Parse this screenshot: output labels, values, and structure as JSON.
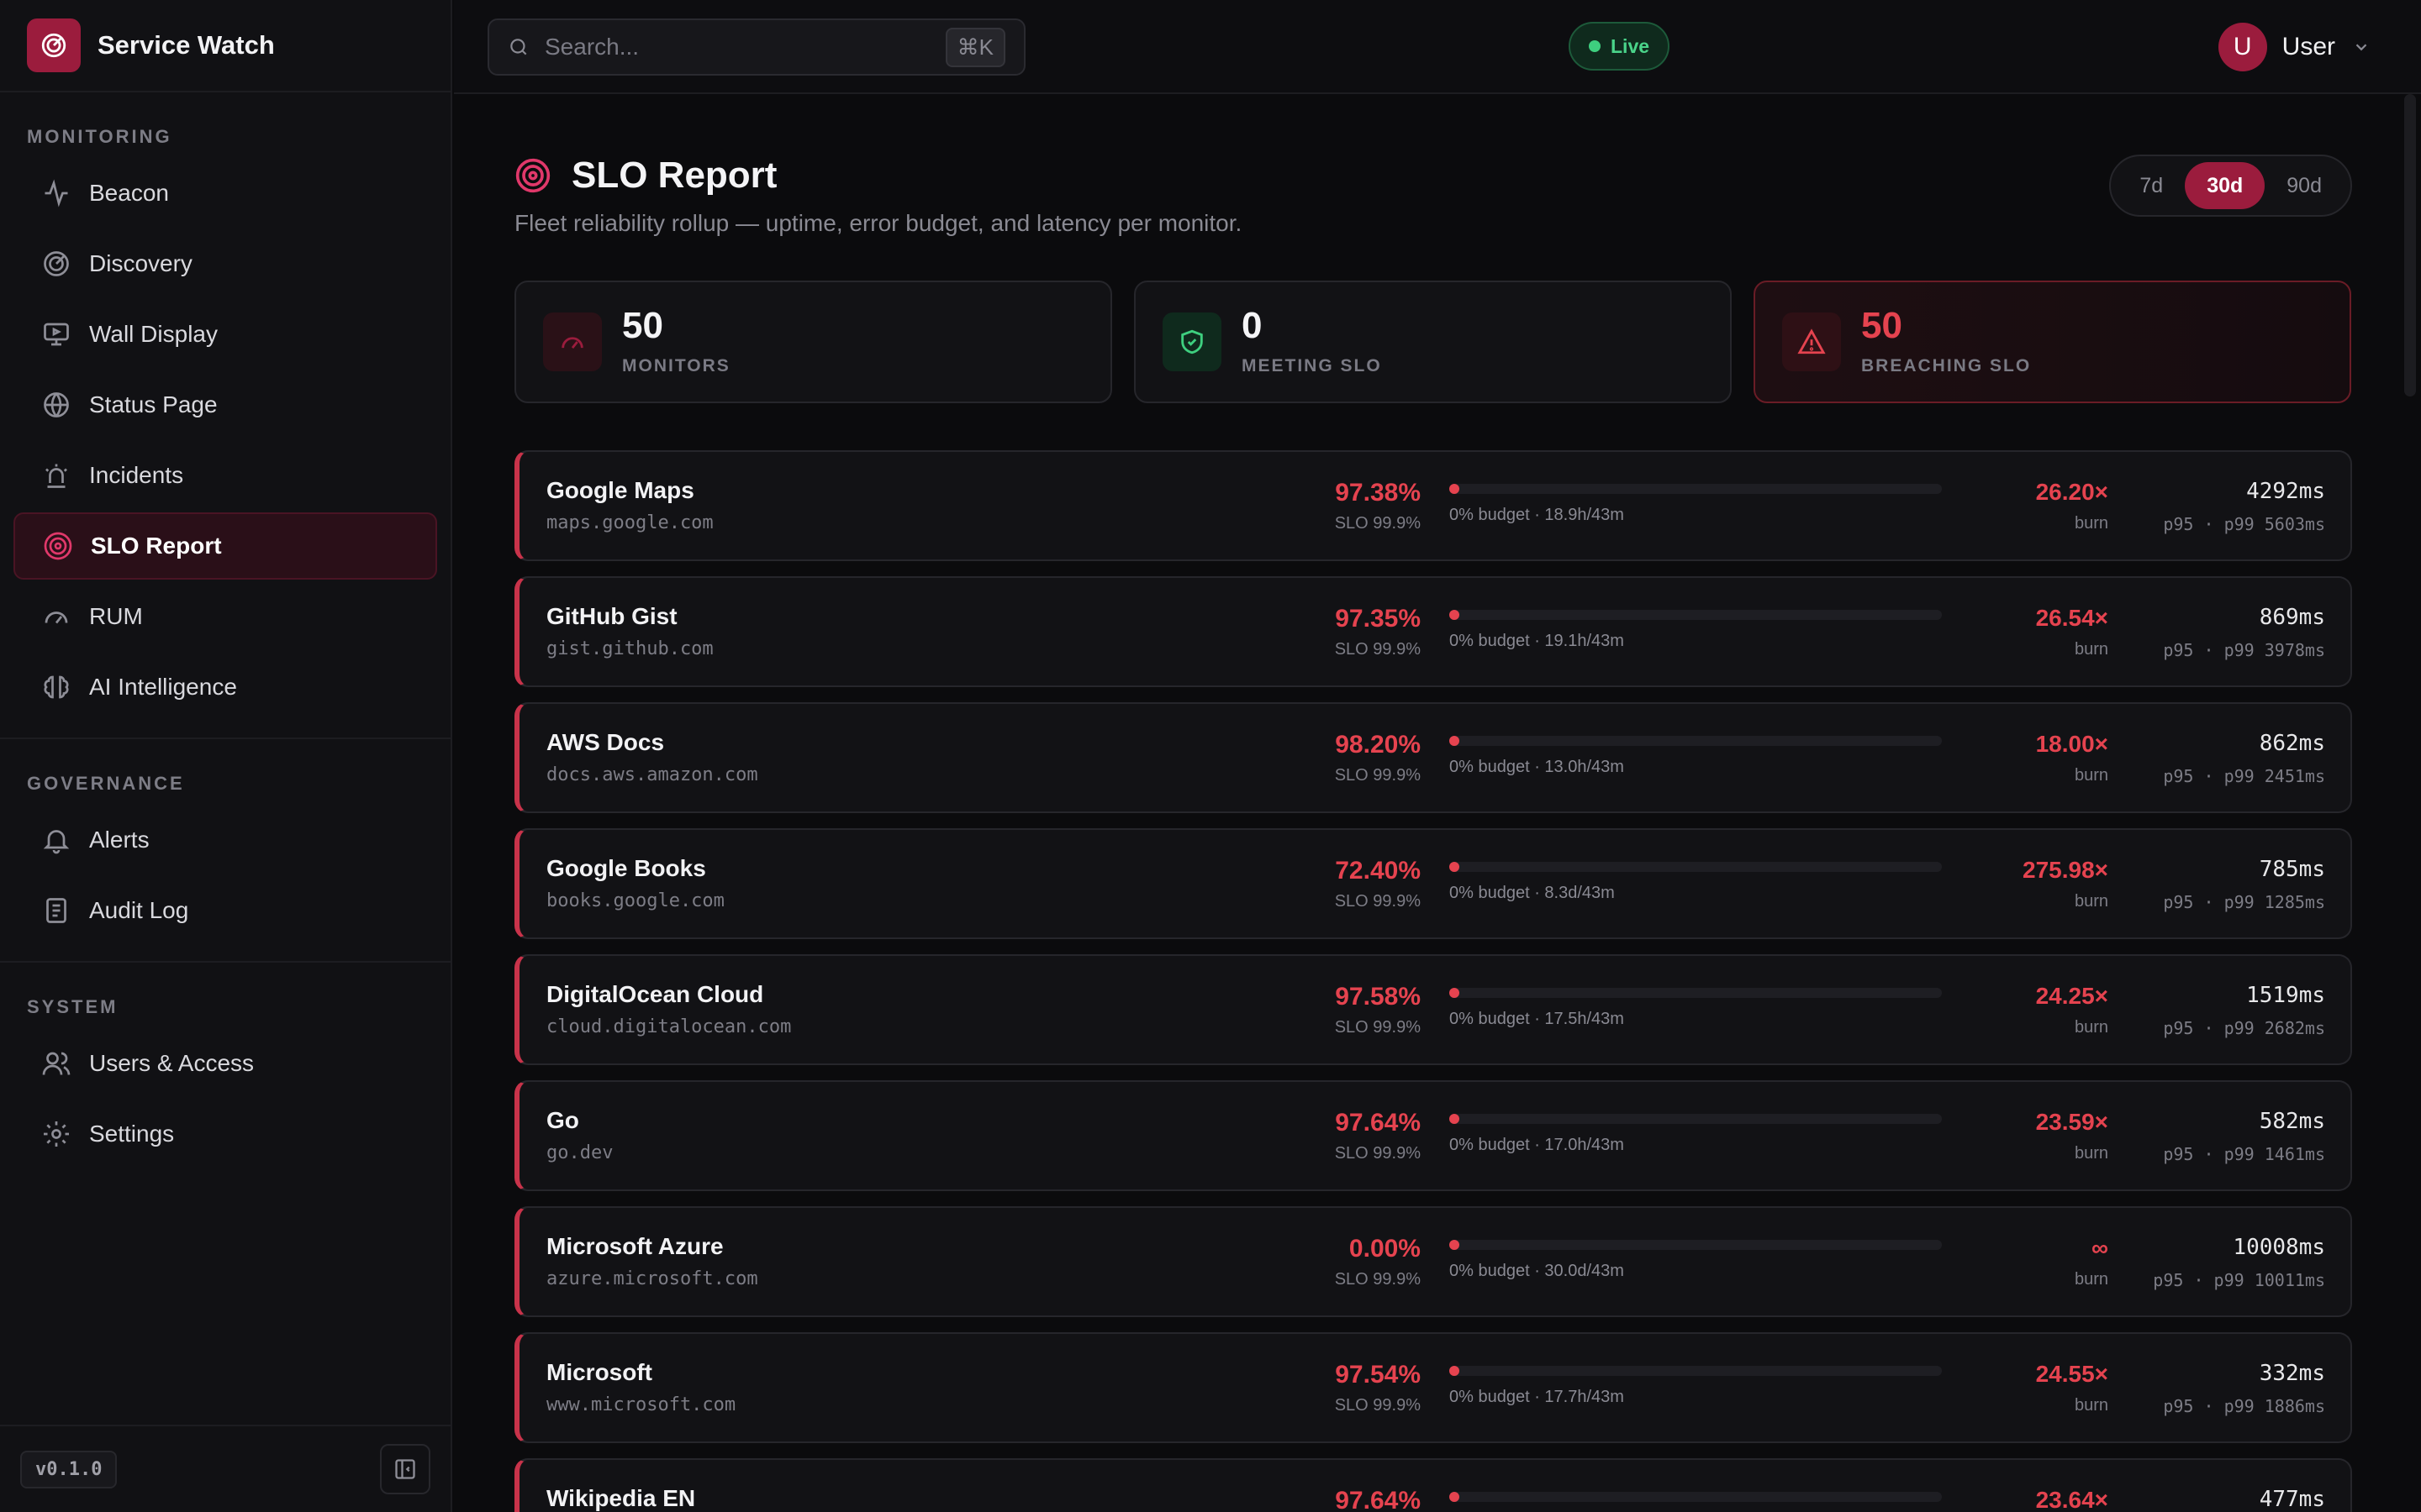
{
  "brand": {
    "name": "Service Watch"
  },
  "sidebar": {
    "sections": [
      {
        "heading": "MONITORING",
        "items": [
          {
            "label": "Beacon",
            "icon": "activity-icon"
          },
          {
            "label": "Discovery",
            "icon": "radar-icon"
          },
          {
            "label": "Wall Display",
            "icon": "monitor-icon"
          },
          {
            "label": "Status Page",
            "icon": "globe-icon"
          },
          {
            "label": "Incidents",
            "icon": "siren-icon"
          },
          {
            "label": "SLO Report",
            "icon": "target-icon",
            "active": true
          },
          {
            "label": "RUM",
            "icon": "gauge-icon"
          },
          {
            "label": "AI Intelligence",
            "icon": "brain-icon"
          }
        ]
      },
      {
        "heading": "GOVERNANCE",
        "items": [
          {
            "label": "Alerts",
            "icon": "bell-icon"
          },
          {
            "label": "Audit Log",
            "icon": "scroll-icon"
          }
        ]
      },
      {
        "heading": "SYSTEM",
        "items": [
          {
            "label": "Users & Access",
            "icon": "users-icon"
          },
          {
            "label": "Settings",
            "icon": "gear-icon"
          }
        ]
      }
    ],
    "version": "v0.1.0"
  },
  "topbar": {
    "search_placeholder": "Search...",
    "search_shortcut": "⌘K",
    "live_label": "Live",
    "user_initial": "U",
    "user_name": "User"
  },
  "page": {
    "title": "SLO Report",
    "subtitle": "Fleet reliability rollup — uptime, error budget, and latency per monitor.",
    "ranges": [
      "7d",
      "30d",
      "90d"
    ],
    "selected_range": "30d"
  },
  "stats": [
    {
      "value": "50",
      "label": "MONITORS",
      "kind": "neutral"
    },
    {
      "value": "0",
      "label": "MEETING SLO",
      "kind": "good"
    },
    {
      "value": "50",
      "label": "BREACHING SLO",
      "kind": "breach"
    }
  ],
  "colors": {
    "accent": "#9b1c3d",
    "danger": "#e5434f",
    "good": "#3ecf7f"
  },
  "monitors": [
    {
      "name": "Google Maps",
      "host": "maps.google.com",
      "uptime": "97.38%",
      "slo": "SLO 99.9%",
      "budget_remaining": 0,
      "budget": "0% budget · 18.9h/43m",
      "burn": "26.20×",
      "burn_label": "burn",
      "p95": "4292ms",
      "p_line": "p95 · p99 5603ms"
    },
    {
      "name": "GitHub Gist",
      "host": "gist.github.com",
      "uptime": "97.35%",
      "slo": "SLO 99.9%",
      "budget_remaining": 0,
      "budget": "0% budget · 19.1h/43m",
      "burn": "26.54×",
      "burn_label": "burn",
      "p95": "869ms",
      "p_line": "p95 · p99 3978ms"
    },
    {
      "name": "AWS Docs",
      "host": "docs.aws.amazon.com",
      "uptime": "98.20%",
      "slo": "SLO 99.9%",
      "budget_remaining": 0,
      "budget": "0% budget · 13.0h/43m",
      "burn": "18.00×",
      "burn_label": "burn",
      "p95": "862ms",
      "p_line": "p95 · p99 2451ms"
    },
    {
      "name": "Google Books",
      "host": "books.google.com",
      "uptime": "72.40%",
      "slo": "SLO 99.9%",
      "budget_remaining": 0,
      "budget": "0% budget · 8.3d/43m",
      "burn": "275.98×",
      "burn_label": "burn",
      "p95": "785ms",
      "p_line": "p95 · p99 1285ms"
    },
    {
      "name": "DigitalOcean Cloud",
      "host": "cloud.digitalocean.com",
      "uptime": "97.58%",
      "slo": "SLO 99.9%",
      "budget_remaining": 0,
      "budget": "0% budget · 17.5h/43m",
      "burn": "24.25×",
      "burn_label": "burn",
      "p95": "1519ms",
      "p_line": "p95 · p99 2682ms"
    },
    {
      "name": "Go",
      "host": "go.dev",
      "uptime": "97.64%",
      "slo": "SLO 99.9%",
      "budget_remaining": 0,
      "budget": "0% budget · 17.0h/43m",
      "burn": "23.59×",
      "burn_label": "burn",
      "p95": "582ms",
      "p_line": "p95 · p99 1461ms"
    },
    {
      "name": "Microsoft Azure",
      "host": "azure.microsoft.com",
      "uptime": "0.00%",
      "slo": "SLO 99.9%",
      "budget_remaining": 0,
      "budget": "0% budget · 30.0d/43m",
      "burn": "∞",
      "burn_label": "burn",
      "p95": "10008ms",
      "p_line": "p95 · p99 10011ms"
    },
    {
      "name": "Microsoft",
      "host": "www.microsoft.com",
      "uptime": "97.54%",
      "slo": "SLO 99.9%",
      "budget_remaining": 0,
      "budget": "0% budget · 17.7h/43m",
      "burn": "24.55×",
      "burn_label": "burn",
      "p95": "332ms",
      "p_line": "p95 · p99 1886ms"
    },
    {
      "name": "Wikipedia EN",
      "host": "",
      "uptime": "97.64%",
      "slo": "",
      "budget_remaining": 0,
      "budget": "",
      "burn": "23.64×",
      "burn_label": "",
      "p95": "477ms",
      "p_line": ""
    }
  ]
}
